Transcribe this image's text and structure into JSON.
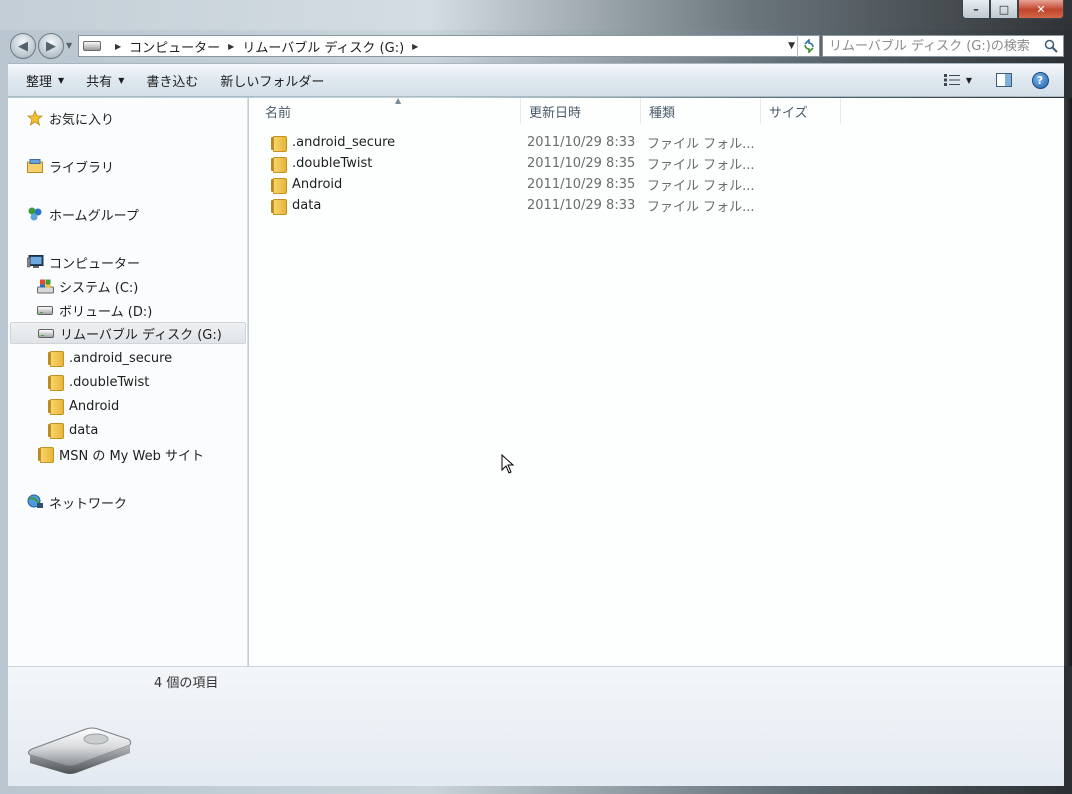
{
  "window": {
    "caption_min": "–",
    "caption_max": "□",
    "caption_close": "✕"
  },
  "address": {
    "crumbs": [
      "コンピューター",
      "リムーバブル ディスク (G:)"
    ]
  },
  "search": {
    "placeholder": "リムーバブル ディスク (G:)の検索"
  },
  "toolbar": {
    "organize": "整理",
    "share": "共有",
    "burn": "書き込む",
    "new_folder": "新しいフォルダー"
  },
  "navpane": {
    "favorites": "お気に入り",
    "libraries": "ライブラリ",
    "homegroup": "ホームグループ",
    "computer": "コンピューター",
    "system_c": "システム (C:)",
    "volume_d": "ボリューム (D:)",
    "removable_g": "リムーバブル ディスク (G:)",
    "sub_folders": [
      ".android_secure",
      ".doubleTwist",
      "Android",
      "data"
    ],
    "msn": "MSN の My Web サイト",
    "network": "ネットワーク"
  },
  "columns": {
    "name": "名前",
    "date": "更新日時",
    "type": "種類",
    "size": "サイズ"
  },
  "files": [
    {
      "name": ".android_secure",
      "date": "2011/10/29 8:33",
      "type": "ファイル フォル..."
    },
    {
      "name": ".doubleTwist",
      "date": "2011/10/29 8:35",
      "type": "ファイル フォル..."
    },
    {
      "name": "Android",
      "date": "2011/10/29 8:35",
      "type": "ファイル フォル..."
    },
    {
      "name": "data",
      "date": "2011/10/29 8:33",
      "type": "ファイル フォル..."
    }
  ],
  "details": {
    "count": "4 個の項目"
  },
  "colors": {
    "accent": "#2b6fb4",
    "folder": "#e8b53a"
  }
}
